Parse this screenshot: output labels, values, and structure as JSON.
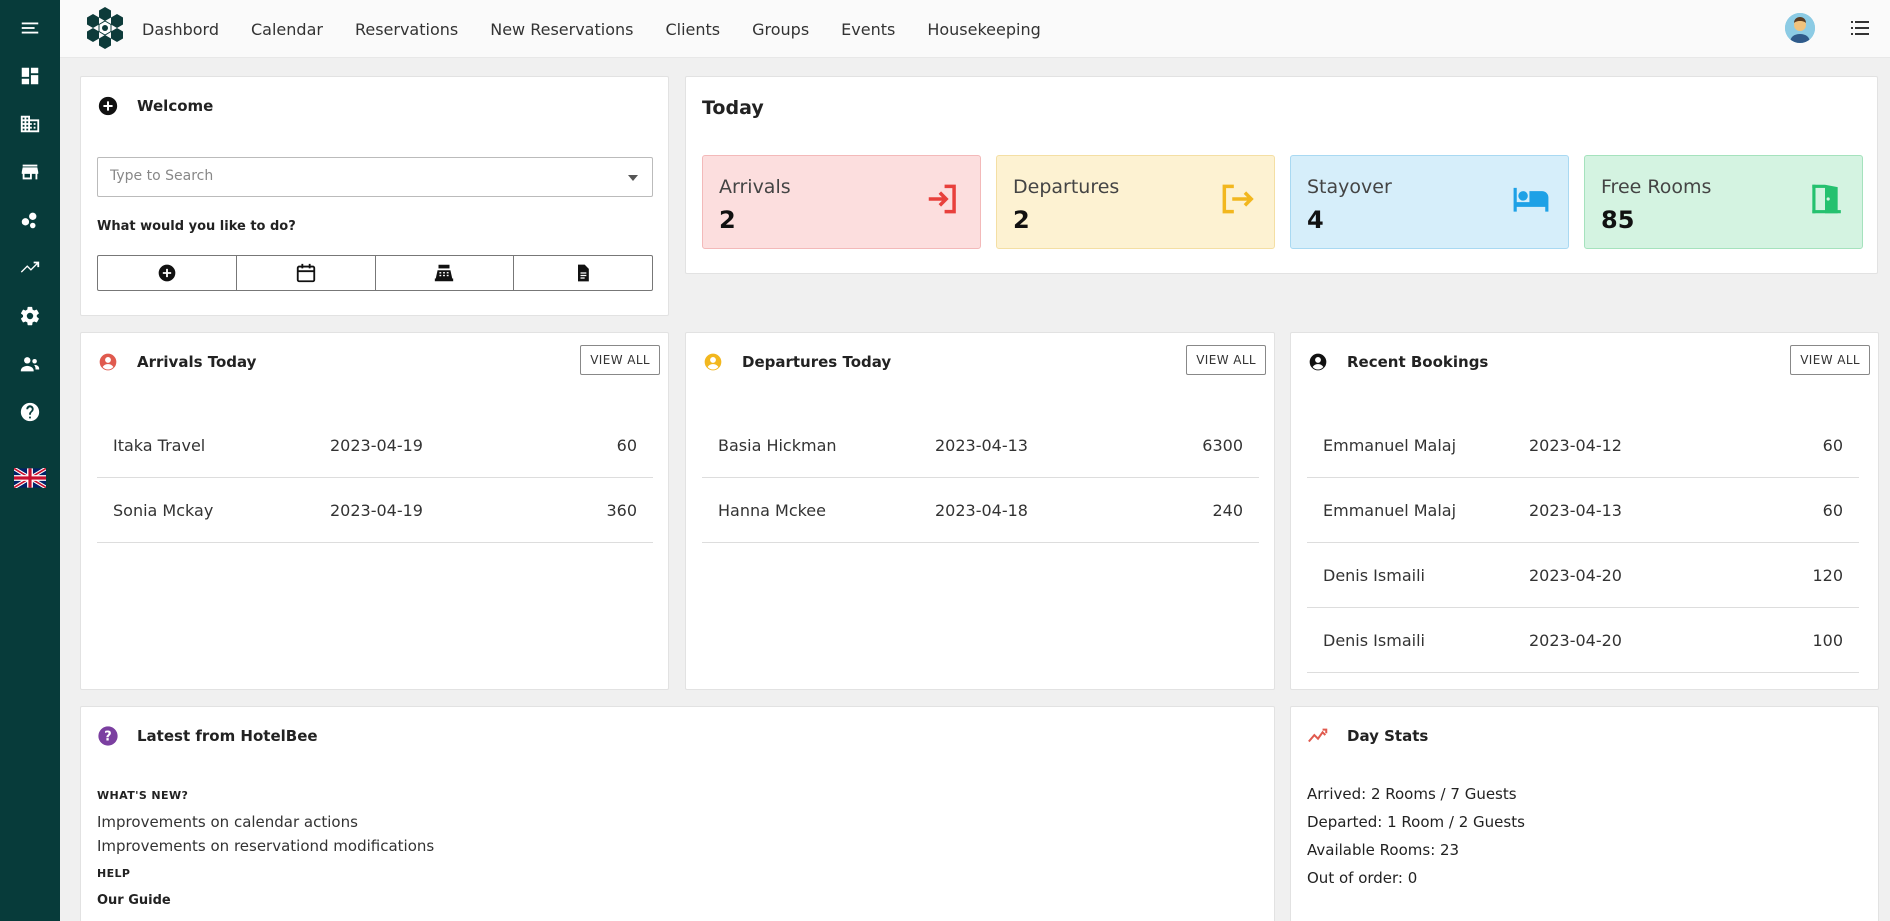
{
  "sidebar": {
    "items": [
      {
        "icon": "menu-icon"
      },
      {
        "icon": "dashboard-icon"
      },
      {
        "icon": "building-icon"
      },
      {
        "icon": "store-icon"
      },
      {
        "icon": "bubbles-icon"
      },
      {
        "icon": "trend-icon"
      },
      {
        "icon": "gear-icon"
      },
      {
        "icon": "users-icon"
      },
      {
        "icon": "help-icon"
      },
      {
        "icon": "uk-flag-icon"
      }
    ]
  },
  "nav": {
    "items": [
      "Dashbord",
      "Calendar",
      "Reservations",
      "New Reservations",
      "Clients",
      "Groups",
      "Events",
      "Housekeeping"
    ]
  },
  "welcome": {
    "title": "Welcome",
    "search_placeholder": "Type to Search",
    "question": "What would you like to do?",
    "quick_actions": [
      "add-circle-icon",
      "calendar-icon",
      "cash-register-icon",
      "document-icon"
    ]
  },
  "today": {
    "title": "Today",
    "stats": [
      {
        "label": "Arrivals",
        "value": "2",
        "icon": "login-icon",
        "bg": "#fcdede",
        "border": "#f3b9b9",
        "accent": "#e8403c"
      },
      {
        "label": "Departures",
        "value": "2",
        "icon": "logout-icon",
        "bg": "#fdf2d2",
        "border": "#f4dfa4",
        "accent": "#f2b71e"
      },
      {
        "label": "Stayover",
        "value": "4",
        "icon": "bed-icon",
        "bg": "#d6eefa",
        "border": "#a9d9f2",
        "accent": "#1ea1e6"
      },
      {
        "label": "Free Rooms",
        "value": "85",
        "icon": "door-open-icon",
        "bg": "#d4f3e1",
        "border": "#a5e2bd",
        "accent": "#25c16f"
      }
    ]
  },
  "arrivals": {
    "title": "Arrivals Today",
    "view_all": "VIEW ALL",
    "rows": [
      {
        "name": "Itaka Travel",
        "date": "2023-04-19",
        "amount": "60"
      },
      {
        "name": "Sonia Mckay",
        "date": "2023-04-19",
        "amount": "360"
      }
    ]
  },
  "departures": {
    "title": "Departures Today",
    "view_all": "VIEW ALL",
    "rows": [
      {
        "name": "Basia Hickman",
        "date": "2023-04-13",
        "amount": "6300"
      },
      {
        "name": "Hanna Mckee",
        "date": "2023-04-18",
        "amount": "240"
      }
    ]
  },
  "recent": {
    "title": "Recent Bookings",
    "view_all": "VIEW ALL",
    "rows": [
      {
        "name": "Emmanuel Malaj",
        "date": "2023-04-12",
        "amount": "60"
      },
      {
        "name": "Emmanuel Malaj",
        "date": "2023-04-13",
        "amount": "60"
      },
      {
        "name": "Denis Ismaili",
        "date": "2023-04-20",
        "amount": "120"
      },
      {
        "name": "Denis Ismaili",
        "date": "2023-04-20",
        "amount": "100"
      }
    ]
  },
  "latest": {
    "title": "Latest from HotelBee",
    "whats_new": "WHAT'S NEW?",
    "news": [
      "Improvements on calendar actions",
      "Improvements on reservationd modifications"
    ],
    "help": "HELP",
    "guide": "Our Guide"
  },
  "daystats": {
    "title": "Day Stats",
    "lines": [
      "Arrived: 2 Rooms / 7 Guests",
      "Departed: 1 Room / 2 Guests",
      "Available Rooms: 23",
      "Out of order: 0"
    ]
  },
  "colors": {
    "sidebar": "#073b3a",
    "arrivals_icon": "#e05a4e",
    "departures_icon": "#f2b71e",
    "latest_icon": "#7b3fa0",
    "daystats_icon": "#e05a4e"
  }
}
